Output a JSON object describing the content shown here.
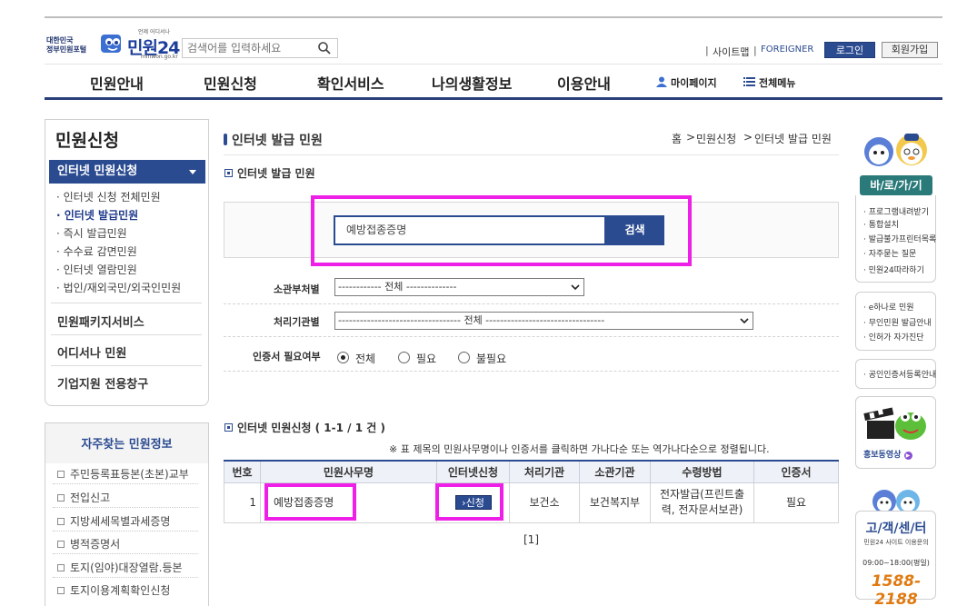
{
  "header": {
    "logo_small_line1": "대한민국",
    "logo_small_line2": "정부민원포털",
    "logo_text": "민원24",
    "logo_tagline": "언제 어디서나",
    "logo_url": "minwon.go.kr",
    "search_placeholder": "검색어를 입력하세요",
    "util_links": [
      "사이트맵",
      "FOREIGNER"
    ],
    "login_label": "로그인",
    "join_label": "회원가입"
  },
  "nav": {
    "items": [
      "민원안내",
      "민원신청",
      "확인서비스",
      "나의생활정보",
      "이용안내"
    ],
    "mypage_label": "마이페이지",
    "allmenu_label": "전체메뉴"
  },
  "sidebar": {
    "title": "민원신청",
    "active": "인터넷 민원신청",
    "sub_items": [
      "인터넷 신청 전체민원",
      "인터넷 발급민원",
      "즉시 발급민원",
      "수수료 감면민원",
      "인터넷 열람민원",
      "법인/재외국민/외국인민원"
    ],
    "menus": [
      "민원패키지서비스",
      "어디서나 민원",
      "기업지원 전용창구"
    ]
  },
  "faq": {
    "title": "자주찾는 민원정보",
    "items": [
      "주민등록표등본(초본)교부",
      "전입신고",
      "지방세세목별과세증명",
      "병적증명서",
      "토지(임야)대장열람.등본",
      "토지이용계획확인신청"
    ]
  },
  "main": {
    "page_title": "인터넷 발급 민원",
    "breadcrumb": [
      "홈",
      "민원신청",
      "인터넷 발급 민원"
    ],
    "section_title": "인터넷 발급 민원",
    "search_value": "예방접종증명",
    "search_button": "검색",
    "filters": {
      "dept_label": "소관부처별",
      "dept_value": "------------ 전체 --------------",
      "org_label": "처리기관별",
      "org_value": "---------------------------------- 전체 ---------------------------------",
      "cert_label": "인증서 필요여부",
      "cert_options": [
        "전체",
        "필요",
        "불필요"
      ],
      "cert_selected": "전체"
    },
    "results_title": "인터넷 민원신청 ( 1-1 / 1 건 )",
    "note": "※ 표 제목의 민원사무명이나 인증서를 클릭하면 가나다순 또는 역가나다순으로 정렬됩니다.",
    "table": {
      "headers": [
        "번호",
        "민원사무명",
        "인터넷신청",
        "처리기관",
        "소관기관",
        "수령방법",
        "인증서"
      ],
      "rows": [
        {
          "no": "1",
          "name": "예방접종증명",
          "apply": "신청",
          "handler": "보건소",
          "owner": "보건복지부",
          "receipt_line1": "전자발급(프린트출",
          "receipt_line2": "력, 전자문서보관)",
          "cert": "필요"
        }
      ]
    },
    "pager": "[1]"
  },
  "right": {
    "baro_title": "바/로/가/기",
    "links1": [
      "프로그램내려받기",
      "통합설치",
      "발급불가프린터목록",
      "자주묻는 질문",
      "민원24따라하기"
    ],
    "links2": [
      "e하나로 민원",
      "무인민원 발급안내",
      "인허가 자가진단"
    ],
    "links3": [
      "공인인증서등록안내"
    ],
    "video_label": "홍보동영상",
    "cust_title": "고/객/센/터",
    "cust_sub": "민원24 사이트 이용문의",
    "cust_hours": "09:00~18:00(평일)",
    "cust_phone": "1588-2188"
  },
  "colors": {
    "brand_blue": "#2b4b91",
    "highlight": "#ee1fe6",
    "phone_orange": "#e07a10"
  }
}
